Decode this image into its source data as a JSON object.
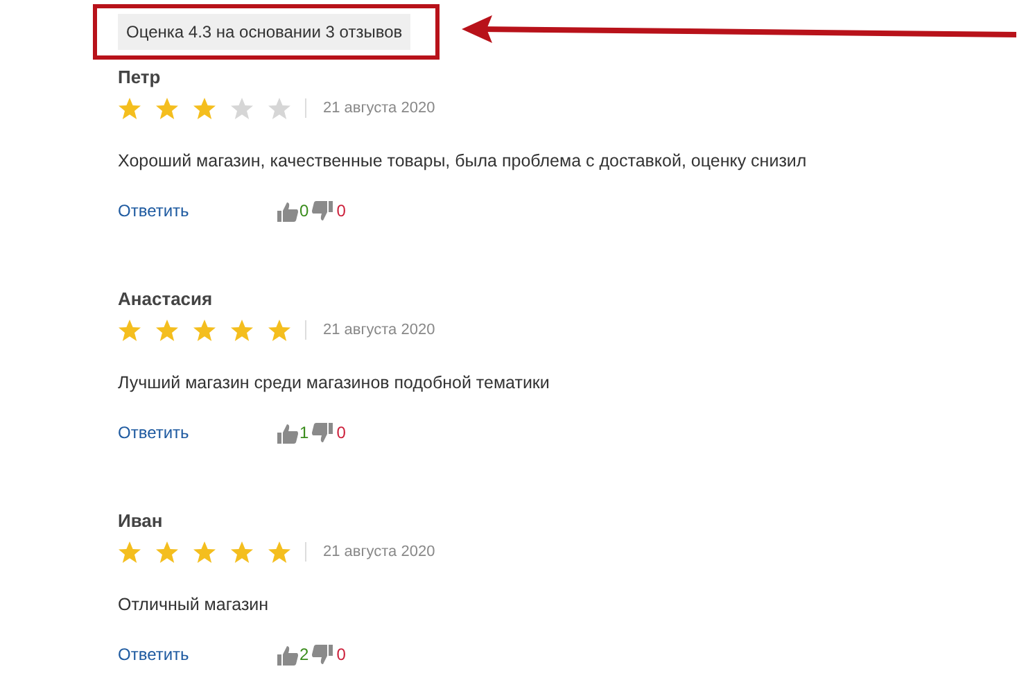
{
  "summary": {
    "text": "Оценка 4.3 на основании 3 отзывов",
    "highlighted": true
  },
  "reviews": [
    {
      "author": "Петр",
      "stars": 3,
      "date": "21 августа 2020",
      "text": "Хороший магазин, качественные товары, была проблема с доставкой, оценку снизил",
      "reply": "Ответить",
      "likes": "0",
      "dislikes": "0"
    },
    {
      "author": "Анастасия",
      "stars": 5,
      "date": "21 августа 2020",
      "text": "Лучший магазин среди магазинов подобной тематики",
      "reply": "Ответить",
      "likes": "1",
      "dislikes": "0"
    },
    {
      "author": "Иван",
      "stars": 5,
      "date": "21 августа 2020",
      "text": "Отличный магазин",
      "reply": "Ответить",
      "likes": "2",
      "dislikes": "0"
    }
  ]
}
